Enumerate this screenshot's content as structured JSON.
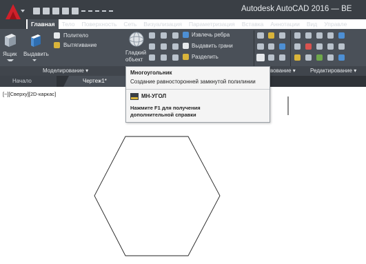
{
  "app": {
    "title": "Autodesk AutoCAD 2016 — BE"
  },
  "ribbon": {
    "tabs": [
      "Главная",
      "Тело",
      "Поверхность",
      "Сеть",
      "Визуализация",
      "Параметризация",
      "Вставка",
      "Аннотации",
      "Вид",
      "Управле"
    ],
    "active_tab": "Главная",
    "modeling": {
      "box_label": "Ящик",
      "extrude_label": "Выдавить",
      "polysolid_label": "Политело",
      "presspull_label": "Вытягивание",
      "smooth_label_1": "Гладкий",
      "smooth_label_2": "объект",
      "extract_edges_label": "Извлечь ребра",
      "extrude_faces_label": "Выдавить грани",
      "split_label": "Разделить"
    },
    "footer": {
      "modeling_panel": "Моделирование",
      "section_panel": "вование",
      "edit_panel": "Редактирование"
    }
  },
  "document_tabs": {
    "start": "Начало",
    "drawing": "Чертеж1*"
  },
  "viewport": {
    "label": "[−][Сверху][2D-каркас]"
  },
  "tooltip": {
    "title": "Многоугольник",
    "description": "Создание равносторонней замкнутой полилинии",
    "command": "МН-УГОЛ",
    "help": "Нажмите F1 для получения дополнительной справки"
  },
  "colors": {
    "titlebar": "#3a3f45",
    "ribbon": "#4a5058",
    "accent_red": "#c8232c",
    "canvas": "#ffffff"
  },
  "icons": [
    "autocad-logo-icon",
    "new-icon",
    "open-icon",
    "save-icon",
    "print-icon",
    "undo-icon",
    "redo-icon",
    "box-icon",
    "extrude-icon",
    "polygon-icon"
  ]
}
